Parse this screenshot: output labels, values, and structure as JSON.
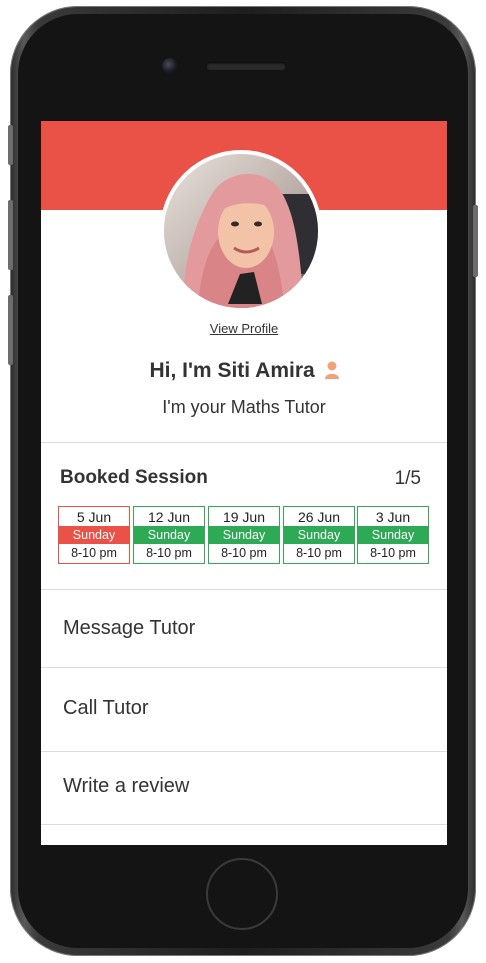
{
  "profile": {
    "view_profile_label": "View Profile",
    "greeting": "Hi, I'm Siti Amira",
    "subtitle": "I'm your Maths Tutor",
    "avatar_icon": "user-icon"
  },
  "booked": {
    "title": "Booked Session",
    "count": "1/5",
    "sessions": [
      {
        "date": "5 Jun",
        "day": "Sunday",
        "time": "8-10 pm",
        "status": "active"
      },
      {
        "date": "12 Jun",
        "day": "Sunday",
        "time": "8-10 pm",
        "status": "upcoming"
      },
      {
        "date": "19 Jun",
        "day": "Sunday",
        "time": "8-10 pm",
        "status": "upcoming"
      },
      {
        "date": "26 Jun",
        "day": "Sunday",
        "time": "8-10 pm",
        "status": "upcoming"
      },
      {
        "date": "3 Jun",
        "day": "Sunday",
        "time": "8-10 pm",
        "status": "upcoming"
      }
    ]
  },
  "menu": {
    "message": "Message Tutor",
    "call": "Call Tutor",
    "review": "Write a review"
  },
  "colors": {
    "accent_red": "#ea5247",
    "session_green": "#2ea955"
  }
}
